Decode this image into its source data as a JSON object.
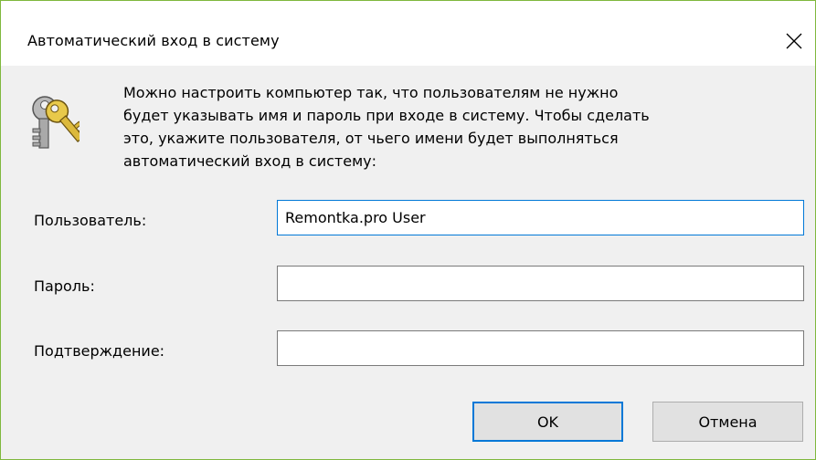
{
  "window": {
    "title": "Автоматический вход в систему",
    "accent_border_color": "#7fb83d",
    "close_icon": "close-icon"
  },
  "dialog": {
    "icon": "keys-icon",
    "description_lines": [
      "Можно настроить компьютер так, что пользователям не нужно",
      "будет указывать имя и пароль при входе в систему. Чтобы сделать",
      "это, укажите пользователя, от чьего имени будет выполняться",
      "автоматический вход в систему:"
    ]
  },
  "fields": {
    "user": {
      "label": "Пользователь:",
      "value": "Remontka.pro User"
    },
    "password": {
      "label": "Пароль:",
      "value": ""
    },
    "confirm": {
      "label": "Подтверждение:",
      "value": ""
    }
  },
  "buttons": {
    "ok_label": "OK",
    "cancel_label": "Отмена"
  }
}
